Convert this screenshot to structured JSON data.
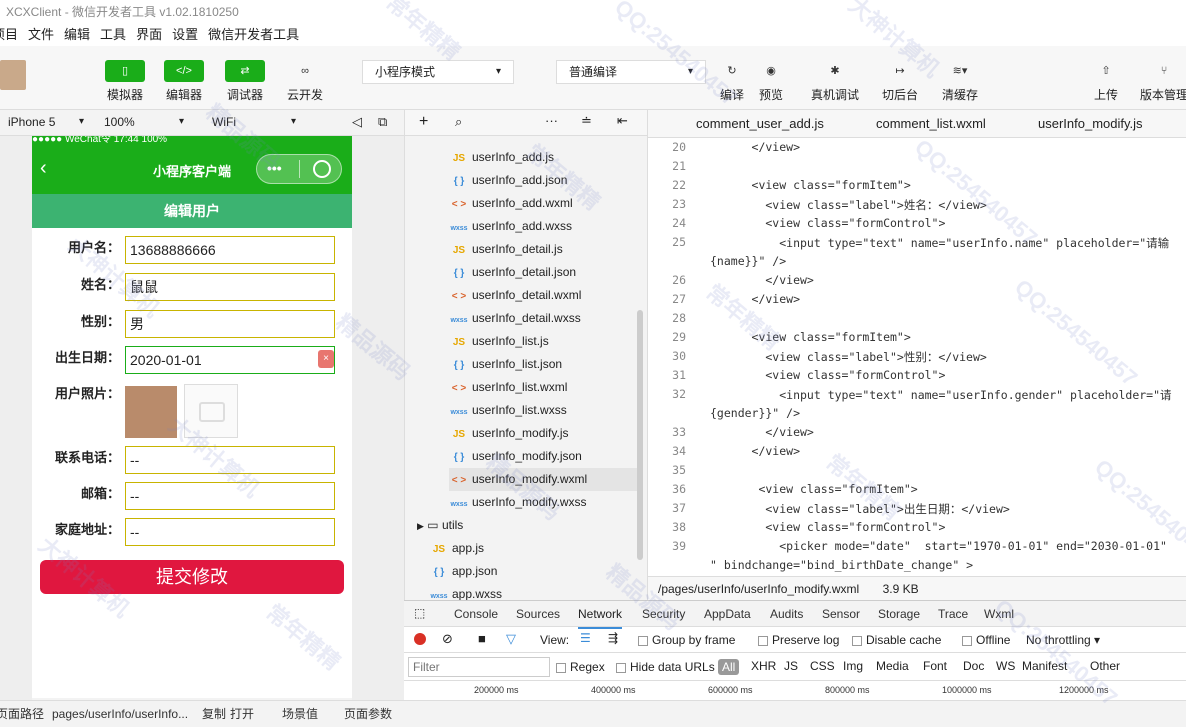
{
  "window": {
    "title": "XCXClient - 微信开发者工具 v1.02.1810250"
  },
  "menu": [
    "项目",
    "文件",
    "编辑",
    "工具",
    "界面",
    "设置",
    "微信开发者工具"
  ],
  "toolbar": {
    "simulator": "模拟器",
    "editor": "编辑器",
    "debugger": "调试器",
    "cloud": "云开发",
    "mode": "小程序模式",
    "compile_mode": "普通编译",
    "compile": "编译",
    "preview": "预览",
    "remote_debug": "真机调试",
    "background": "切后台",
    "clear_cache": "清缓存",
    "upload": "上传",
    "version": "版本管理"
  },
  "simulator_bar": {
    "device": "iPhone 5",
    "zoom": "100%",
    "network": "WiFi"
  },
  "phone": {
    "status": "●●●●● WeChat令   17:44   100%",
    "nav_title": "小程序客户端",
    "banner": "编辑用户",
    "fields": [
      {
        "label": "用户名：",
        "value": "13688886666"
      },
      {
        "label": "姓名：",
        "value": "鼠鼠"
      },
      {
        "label": "性别：",
        "value": "男"
      },
      {
        "label": "出生日期：",
        "value": "2020-01-01"
      },
      {
        "label": "用户照片：",
        "value": ""
      },
      {
        "label": "联系电话：",
        "value": "--"
      },
      {
        "label": "邮箱：",
        "value": "--"
      },
      {
        "label": "家庭地址：",
        "value": "--"
      }
    ],
    "submit": "提交修改"
  },
  "files": [
    {
      "type": "JS",
      "name": "userInfo_add.js"
    },
    {
      "type": "{ }",
      "name": "userInfo_add.json"
    },
    {
      "type": "< >",
      "name": "userInfo_add.wxml"
    },
    {
      "type": "wxss",
      "name": "userInfo_add.wxss"
    },
    {
      "type": "JS",
      "name": "userInfo_detail.js"
    },
    {
      "type": "{ }",
      "name": "userInfo_detail.json"
    },
    {
      "type": "< >",
      "name": "userInfo_detail.wxml"
    },
    {
      "type": "wxss",
      "name": "userInfo_detail.wxss"
    },
    {
      "type": "JS",
      "name": "userInfo_list.js"
    },
    {
      "type": "{ }",
      "name": "userInfo_list.json"
    },
    {
      "type": "< >",
      "name": "userInfo_list.wxml"
    },
    {
      "type": "wxss",
      "name": "userInfo_list.wxss"
    },
    {
      "type": "JS",
      "name": "userInfo_modify.js"
    },
    {
      "type": "{ }",
      "name": "userInfo_modify.json"
    },
    {
      "type": "< >",
      "name": "userInfo_modify.wxml"
    },
    {
      "type": "wxss",
      "name": "userInfo_modify.wxss"
    }
  ],
  "folders": {
    "utils": "utils",
    "app_js": "app.js",
    "app_json": "app.json",
    "app_wxss": "app.wxss"
  },
  "editor_tabs": [
    "comment_user_add.js",
    "comment_list.wxml",
    "userInfo_modify.js"
  ],
  "code_lines": [
    {
      "n": "20",
      "t": "      </view>"
    },
    {
      "n": "21",
      "t": ""
    },
    {
      "n": "22",
      "t": "      <view class=\"formItem\">"
    },
    {
      "n": "23",
      "t": "        <view class=\"label\">姓名：</view>"
    },
    {
      "n": "24",
      "t": "        <view class=\"formControl\">"
    },
    {
      "n": "25",
      "t": "          <input type=\"text\" name=\"userInfo.name\" placeholder=\"请输"
    },
    {
      "n": "",
      "t": "{name}}\" />"
    },
    {
      "n": "26",
      "t": "        </view>"
    },
    {
      "n": "27",
      "t": "      </view>"
    },
    {
      "n": "28",
      "t": ""
    },
    {
      "n": "29",
      "t": "      <view class=\"formItem\">"
    },
    {
      "n": "30",
      "t": "        <view class=\"label\">性别：</view>"
    },
    {
      "n": "31",
      "t": "        <view class=\"formControl\">"
    },
    {
      "n": "32",
      "t": "          <input type=\"text\" name=\"userInfo.gender\" placeholder=\"请"
    },
    {
      "n": "",
      "t": "{gender}}\" />"
    },
    {
      "n": "33",
      "t": "        </view>"
    },
    {
      "n": "34",
      "t": "      </view>"
    },
    {
      "n": "35",
      "t": ""
    },
    {
      "n": "36",
      "t": "       <view class=\"formItem\">"
    },
    {
      "n": "37",
      "t": "        <view class=\"label\">出生日期：</view>"
    },
    {
      "n": "38",
      "t": "        <view class=\"formControl\">"
    },
    {
      "n": "39",
      "t": "          <picker mode=\"date\"  start=\"1970-01-01\" end=\"2030-01-01\""
    },
    {
      "n": "",
      "t": "\" bindchange=\"bind_birthDate_change\" >"
    }
  ],
  "path_bar": {
    "path": "/pages/userInfo/userInfo_modify.wxml",
    "size": "3.9 KB"
  },
  "devtools": {
    "tabs": [
      "Console",
      "Sources",
      "Network",
      "Security",
      "AppData",
      "Audits",
      "Sensor",
      "Storage",
      "Trace",
      "Wxml"
    ],
    "active": "Network",
    "view_label": "View:",
    "group_by_frame": "Group by frame",
    "preserve_log": "Preserve log",
    "disable_cache": "Disable cache",
    "offline": "Offline",
    "throttling": "No throttling",
    "filter_placeholder": "Filter",
    "regex": "Regex",
    "hide_data_urls": "Hide data URLs",
    "types": [
      "All",
      "XHR",
      "JS",
      "CSS",
      "Img",
      "Media",
      "Font",
      "Doc",
      "WS",
      "Manifest",
      "Other"
    ],
    "timeline": [
      "200000 ms",
      "400000 ms",
      "600000 ms",
      "800000 ms",
      "1000000 ms",
      "1200000 ms"
    ]
  },
  "statusbar": {
    "page_path_label": "页面路径",
    "page_path": "pages/userInfo/userInfo...",
    "copy": "复制",
    "open": "打开",
    "scene": "场景值",
    "params": "页面参数"
  },
  "watermark": [
    "常年精精",
    "QQ:254540457",
    "大神计算机",
    "精品源码"
  ]
}
